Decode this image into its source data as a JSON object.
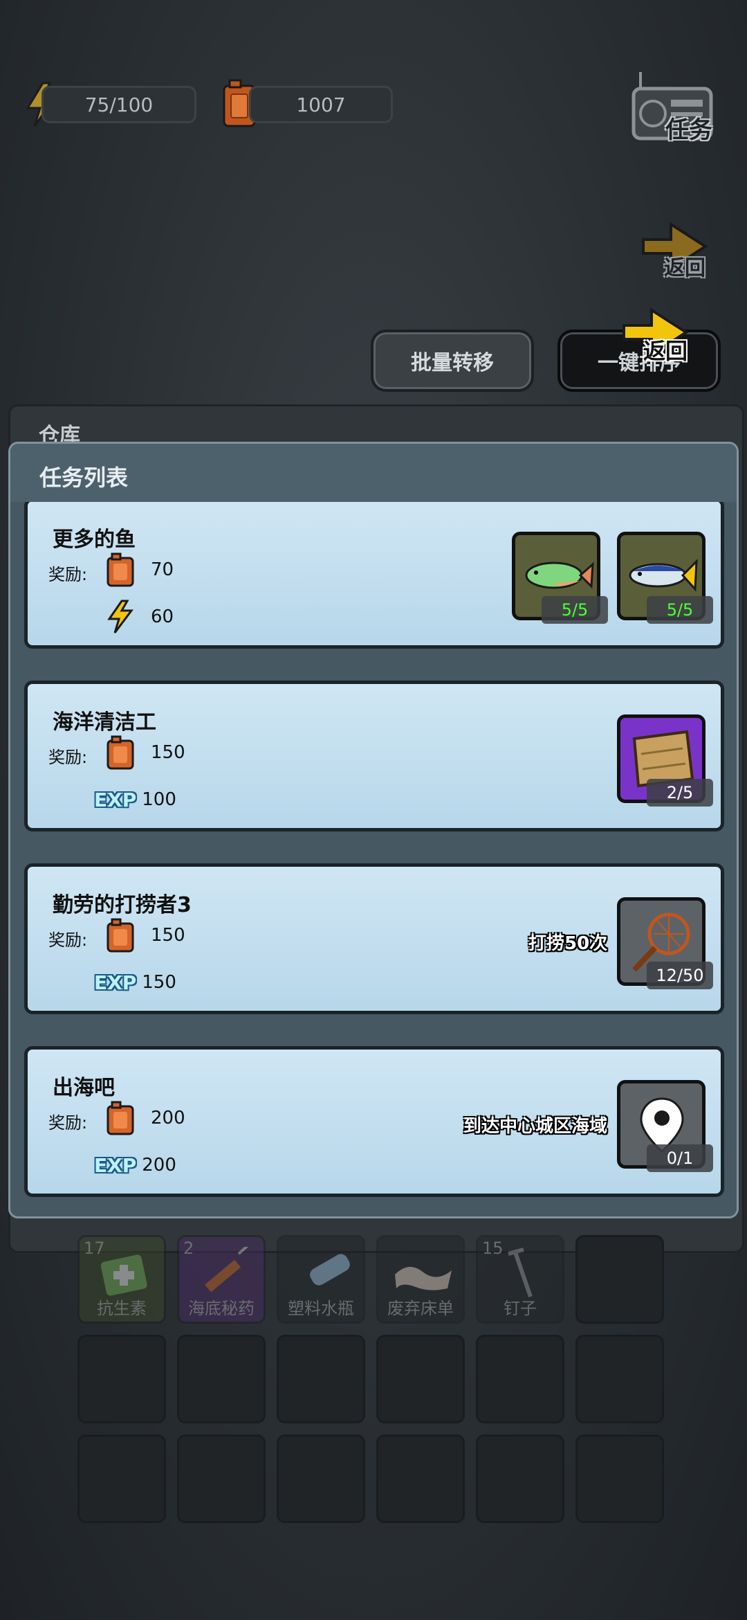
{
  "hud": {
    "energy": "75/100",
    "fuel": "1007",
    "task_label": "任务",
    "back_label": "返回",
    "back_label_front": "返回"
  },
  "toolbar": {
    "batch_transfer": "批量转移",
    "sort": "一键排序"
  },
  "warehouse": {
    "title": "仓库"
  },
  "modal": {
    "title": "任务列表",
    "reward_label": "奖励:",
    "tasks": [
      {
        "name": "更多的鱼",
        "reward_fuel": "70",
        "reward_second_type": "energy",
        "reward_second": "60",
        "requirement": "",
        "items": [
          {
            "icon": "fish-icon",
            "count": "5/5",
            "done": true
          },
          {
            "icon": "tuna-icon",
            "count": "5/5",
            "done": true
          }
        ]
      },
      {
        "name": "海洋清洁工",
        "reward_fuel": "150",
        "reward_second_type": "exp",
        "reward_second": "100",
        "requirement": "",
        "items": [
          {
            "icon": "wood-plank-icon",
            "count": "2/5",
            "done": false
          }
        ]
      },
      {
        "name": "勤劳的打捞者3",
        "reward_fuel": "150",
        "reward_second_type": "exp",
        "reward_second": "150",
        "requirement": "打捞50次",
        "items": [
          {
            "icon": "fishing-net-icon",
            "count": "12/50",
            "done": false
          }
        ]
      },
      {
        "name": "出海吧",
        "reward_fuel": "200",
        "reward_second_type": "exp",
        "reward_second": "200",
        "requirement": "到达中心城区海域",
        "items": [
          {
            "icon": "location-pin-icon",
            "count": "0/1",
            "done": false
          }
        ]
      }
    ],
    "exp_label": "EXP"
  },
  "inventory": [
    {
      "name": "抗生素",
      "count": "17",
      "icon": "antibiotic-icon"
    },
    {
      "name": "海底秘药",
      "count": "2",
      "icon": "syringe-icon"
    },
    {
      "name": "塑料水瓶",
      "count": "",
      "icon": "water-bottle-icon"
    },
    {
      "name": "废弃床单",
      "count": "",
      "icon": "bedsheet-icon"
    },
    {
      "name": "钉子",
      "count": "15",
      "icon": "nail-icon"
    }
  ],
  "colors": {
    "count_done": "#4cff3b",
    "card_bg": "#c6e0f0",
    "modal_bg": "#465862"
  }
}
